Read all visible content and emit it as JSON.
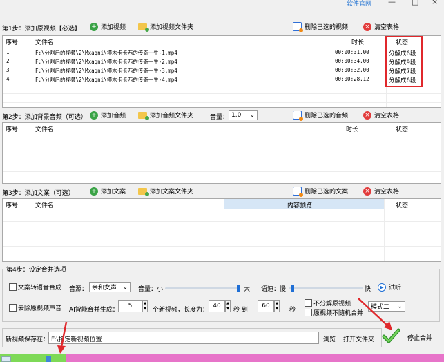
{
  "topbar": {
    "website_link": "软件官网",
    "minimize": "—",
    "maximize": "□",
    "close": "×"
  },
  "step1": {
    "label": "第1步：添加原视频【必选】",
    "add_video": "添加视频",
    "add_video_folder": "添加视频文件夹",
    "delete_selected": "删除已选的视频",
    "clear_table": "清空表格",
    "columns": {
      "no": "序号",
      "filename": "文件名",
      "duration": "时长",
      "status": "状态"
    },
    "rows": [
      {
        "no": "1",
        "filename": "F:\\分割后的视频\\2\\Mxaqni\\摸木卡卡西的传奇一生-1.mp4",
        "duration": "00:00:31.00",
        "status": "分解成6段"
      },
      {
        "no": "2",
        "filename": "F:\\分割后的视频\\2\\Mxaqni\\摸木卡卡西的传奇一生-2.mp4",
        "duration": "00:00:34.00",
        "status": "分解成9段"
      },
      {
        "no": "3",
        "filename": "F:\\分割后的视频\\2\\Mxaqni\\摸木卡卡西的传奇一生-3.mp4",
        "duration": "00:00:32.00",
        "status": "分解成7段"
      },
      {
        "no": "4",
        "filename": "F:\\分割后的视频\\2\\Mxaqni\\摸木卡卡西的传奇一生-4.mp4",
        "duration": "00:00:28.12",
        "status": "分解成6段"
      }
    ]
  },
  "step2": {
    "label": "第2步：添加背景音频（可选）",
    "add_audio": "添加音频",
    "add_audio_folder": "添加音频文件夹",
    "volume_label": "音量：",
    "volume_value": "1.0",
    "delete_selected": "删除已选的音频",
    "clear_table": "清空表格",
    "columns": {
      "no": "序号",
      "filename": "文件名",
      "duration": "时长",
      "status": "状态"
    }
  },
  "step3": {
    "label": "第3步：添加文案（可选）",
    "add_text": "添加文案",
    "add_text_folder": "添加文案文件夹",
    "delete_selected": "删除已选的文案",
    "clear_table": "清空表格",
    "columns": {
      "no": "序号",
      "filename": "文件名",
      "preview": "内容预览",
      "status": "状态"
    }
  },
  "step4": {
    "label": "第4步：设定合并选项",
    "tts_checkbox": "文案转语音合成",
    "voice_label": "音源：",
    "voice_value": "亲和女声",
    "volume_label": "音量：小",
    "volume_max": "大",
    "volume_level": 0.98,
    "speed_label": "语速：慢",
    "speed_max": "快",
    "speed_level": 0.06,
    "listen_button": "试听",
    "remove_audio_checkbox": "去除原视频声音",
    "ai_label": "AI智能合并生成：",
    "count_value": "5",
    "count_suffix": "个新视频，长度为：",
    "min_value": "40",
    "sec_to": "秒 到",
    "max_value": "60",
    "sec": "秒",
    "no_split_checkbox": "不分解原视频",
    "no_random_checkbox": "原视频不随机合并",
    "mode_value": "模式二"
  },
  "output": {
    "save_label": "新视频保存在：",
    "save_path": "F:\\指定新视频位置",
    "browse_button": "浏览",
    "open_folder_button": "打开文件夹",
    "stop_button": "停止合并"
  },
  "colors": {
    "annotation_red": "#e0282c",
    "accent_blue": "#1f6fd5",
    "progress_green": "#7ed957",
    "progress_pink": "#e774c9"
  },
  "progress": {
    "level": 0.15
  }
}
